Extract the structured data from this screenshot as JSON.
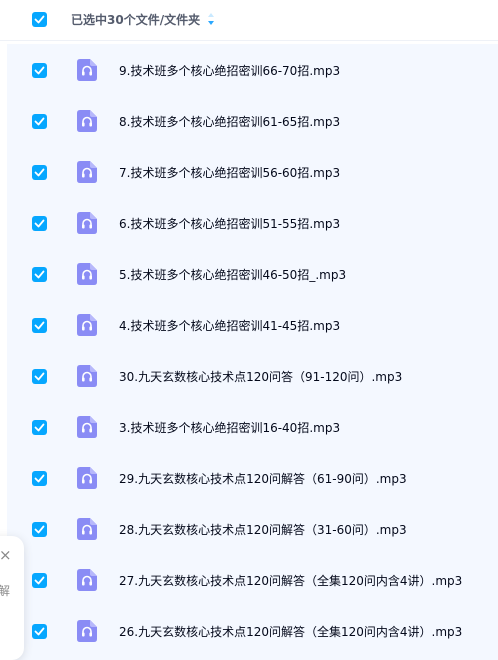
{
  "header": {
    "selection_label": "已选中30个文件/文件夹"
  },
  "files": [
    {
      "name": "9.技术班多个核心绝招密训66-70招.mp3",
      "type": "audio",
      "checked": true
    },
    {
      "name": "8.技术班多个核心绝招密训61-65招.mp3",
      "type": "audio",
      "checked": true
    },
    {
      "name": "7.技术班多个核心绝招密训56-60招.mp3",
      "type": "audio",
      "checked": true
    },
    {
      "name": "6.技术班多个核心绝招密训51-55招.mp3",
      "type": "audio",
      "checked": true
    },
    {
      "name": "5.技术班多个核心绝招密训46-50招_.mp3",
      "type": "audio",
      "checked": true
    },
    {
      "name": "4.技术班多个核心绝招密训41-45招.mp3",
      "type": "audio",
      "checked": true
    },
    {
      "name": "30.九天玄数核心技术点120问答（91-120问）.mp3",
      "type": "audio",
      "checked": true
    },
    {
      "name": "3.技术班多个核心绝招密训16-40招.mp3",
      "type": "audio",
      "checked": true
    },
    {
      "name": "29.九天玄数核心技术点120问解答（61-90问）.mp3",
      "type": "audio",
      "checked": true
    },
    {
      "name": "28.九天玄数核心技术点120问解答（31-60问）.mp3",
      "type": "audio",
      "checked": true
    },
    {
      "name": "27.九天玄数核心技术点120问解答（全集120问内含4讲）.mp3",
      "type": "audio",
      "checked": true
    },
    {
      "name": "26.九天玄数核心技术点120问解答（全集120问内含4讲）.mp3",
      "type": "audio",
      "checked": true
    }
  ],
  "side_panel": {
    "close_glyph": "×",
    "label": "解"
  },
  "colors": {
    "accent": "#06a7ff",
    "icon": "#8a8cf5",
    "row_background": "#f4f8ff",
    "text": "#03081a"
  },
  "icons": {
    "checkbox": "check-icon",
    "file": "audio-file-icon",
    "sort": "sort-icon",
    "close": "close-icon"
  }
}
